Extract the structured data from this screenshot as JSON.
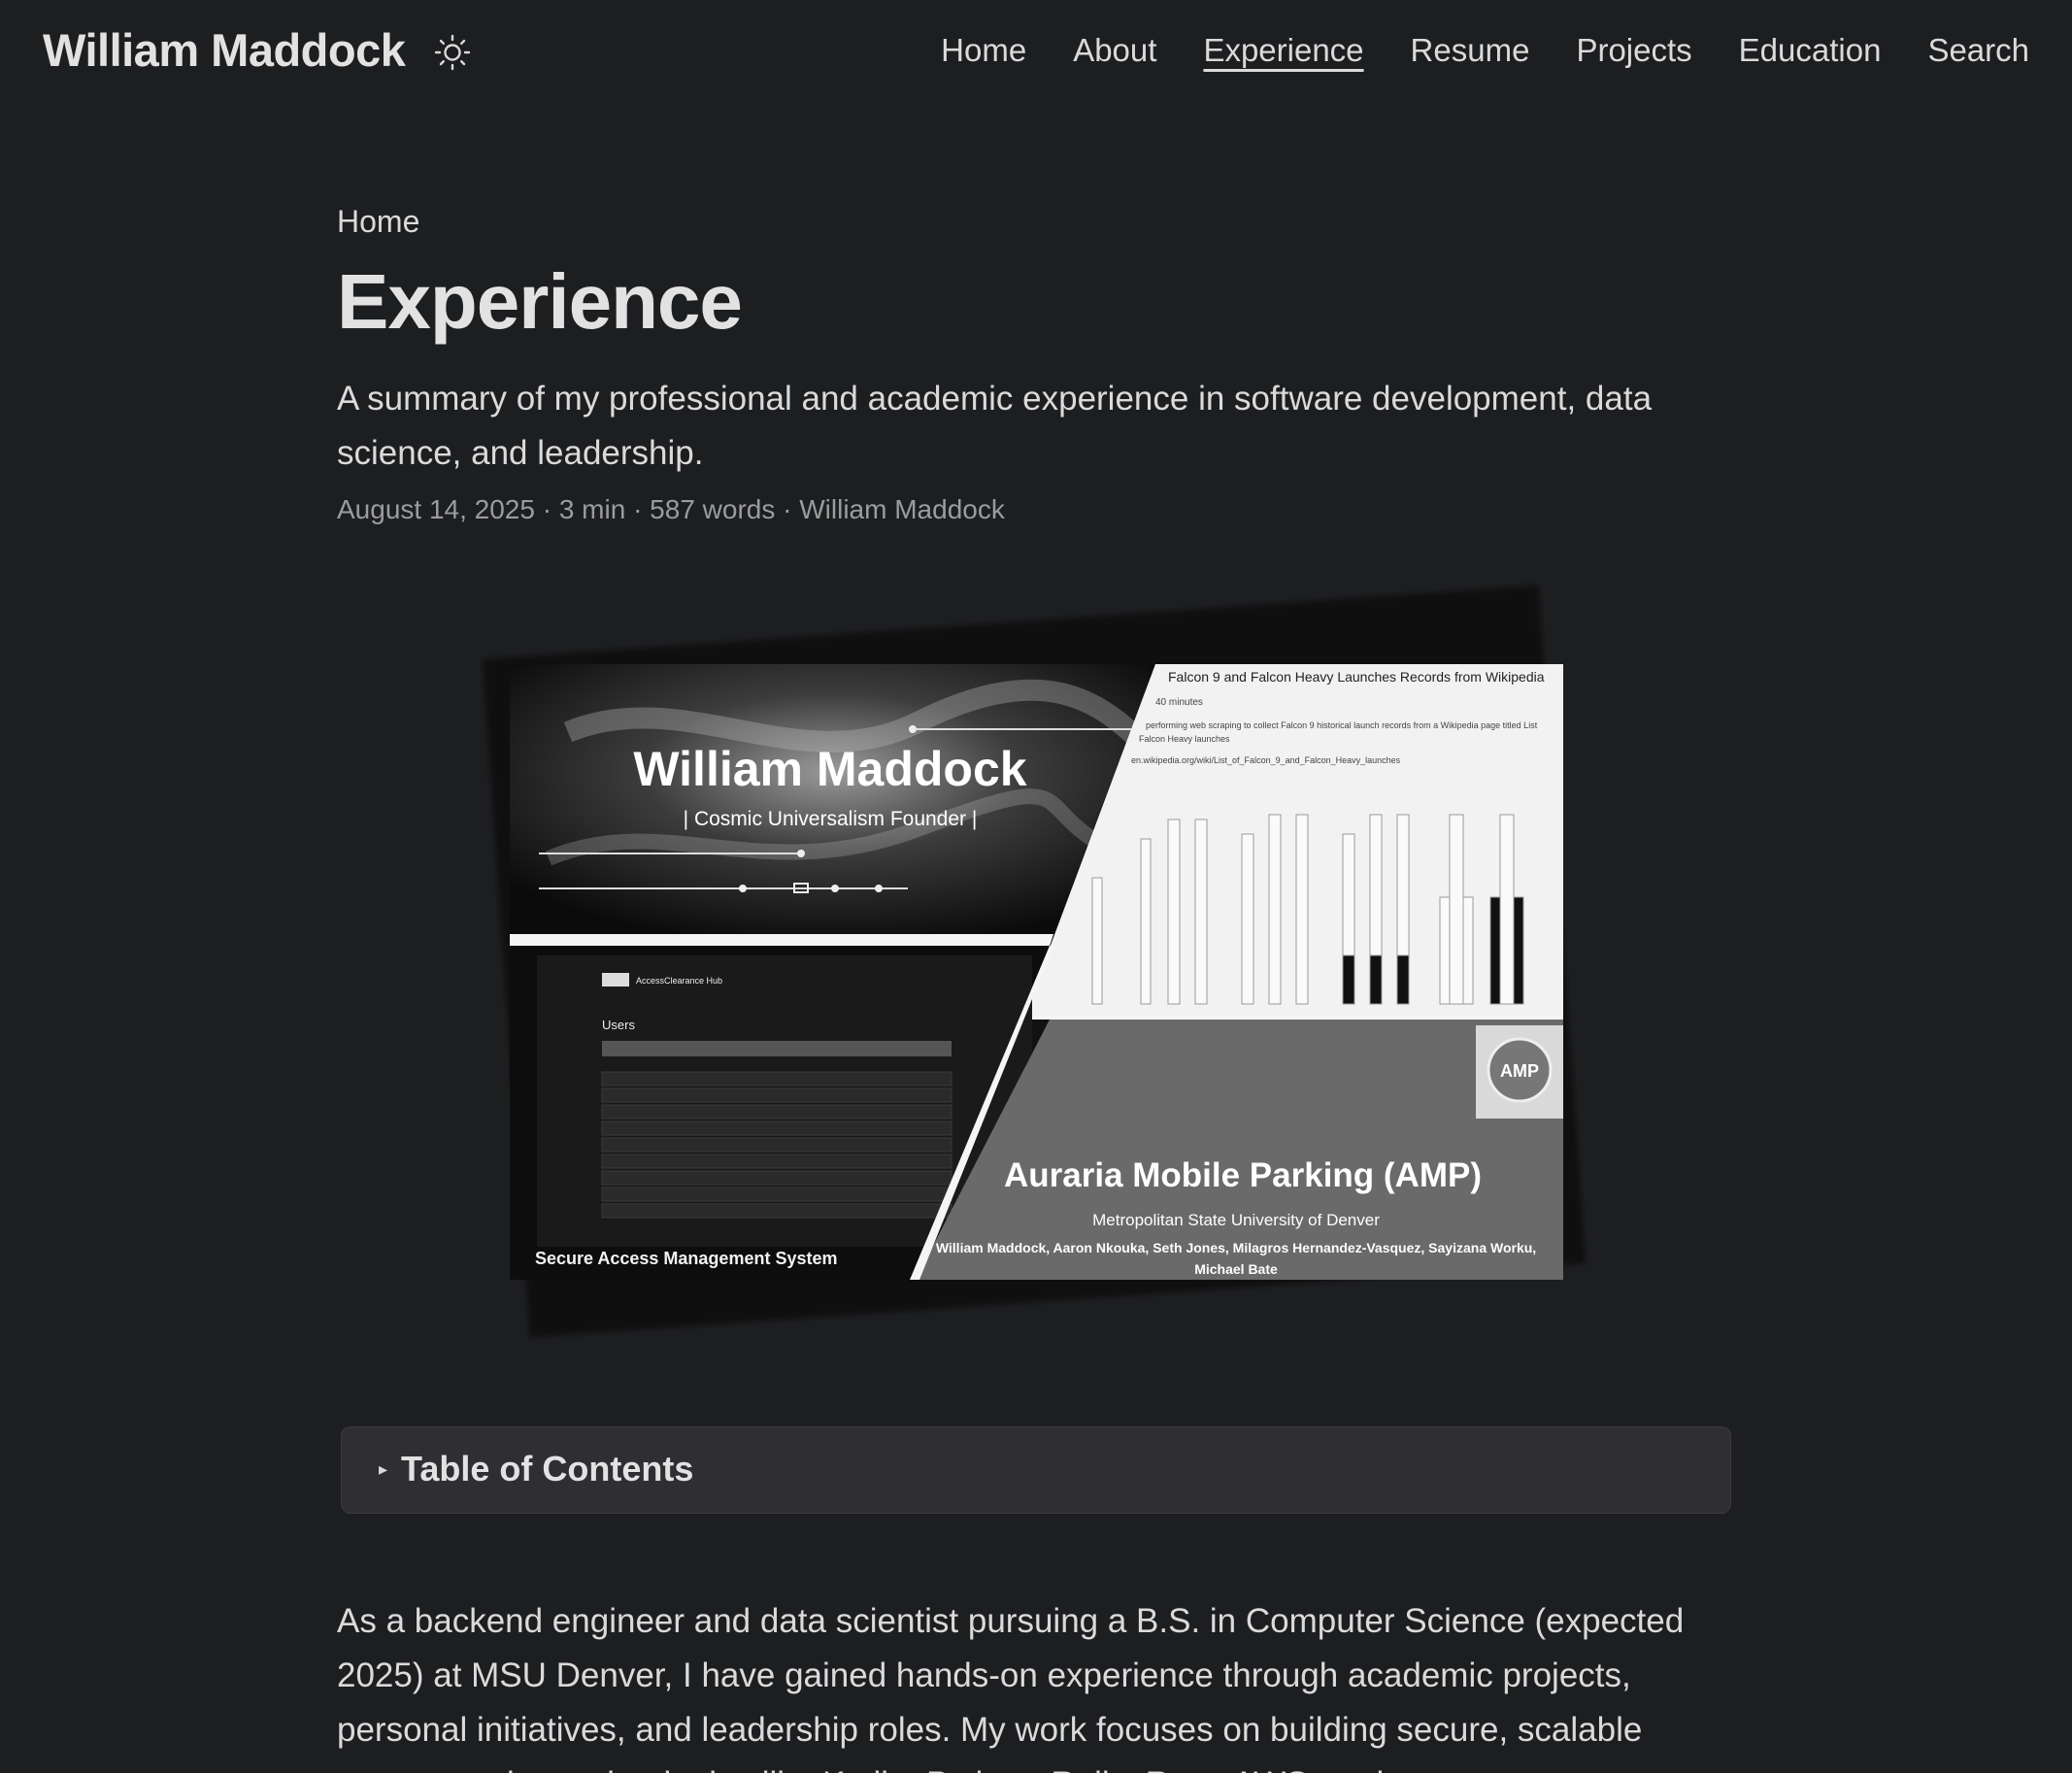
{
  "header": {
    "brand": "William Maddock",
    "theme_toggle_icon": "sun-icon",
    "nav": [
      {
        "label": "Home",
        "active": false
      },
      {
        "label": "About",
        "active": false
      },
      {
        "label": "Experience",
        "active": true
      },
      {
        "label": "Resume",
        "active": false
      },
      {
        "label": "Projects",
        "active": false
      },
      {
        "label": "Education",
        "active": false
      },
      {
        "label": "Search",
        "active": false
      }
    ]
  },
  "breadcrumb": "Home",
  "title": "Experience",
  "description": "A summary of my professional and academic experience in software development, data science, and leadership.",
  "meta": "August 14, 2025 · 3 min · 587 words · William Maddock",
  "cover": {
    "panel1_title": "William Maddock",
    "panel1_subtitle": "| Cosmic Universalism Founder |",
    "panel2_title": "Falcon 9 and Falcon Heavy Launches Records from Wikipedia",
    "panel2_line1": "40 minutes",
    "panel2_line2": "performing web scraping to collect Falcon 9 historical launch records from a Wikipedia page titled List",
    "panel2_line3": "Falcon Heavy launches",
    "panel2_url": "en.wikipedia.org/wiki/List_of_Falcon_9_and_Falcon_Heavy_launches",
    "panel3_app": "AccessClearance Hub",
    "panel3_heading": "Users",
    "panel3_caption": "Secure Access Management System",
    "panel4_logo": "AMP",
    "panel4_title": "Auraria Mobile Parking (AMP)",
    "panel4_org": "Metropolitan State University of Denver",
    "panel4_authors": "William Maddock, Aaron Nkouka, Seth Jones, Milagros Hernandez-Vasquez, Sayizana Worku,",
    "panel4_authors2": "Michael Bate"
  },
  "toc": {
    "label": "Table of Contents",
    "caret": "▸"
  },
  "body": "As a backend engineer and data scientist pursuing a B.S. in Computer Science (expected 2025) at MSU Denver, I have gained hands-on experience through academic projects, personal initiatives, and leadership roles. My work focuses on building secure, scalable systems using technologies like Kotlin, Python, Rails, Rust, AWS, and"
}
